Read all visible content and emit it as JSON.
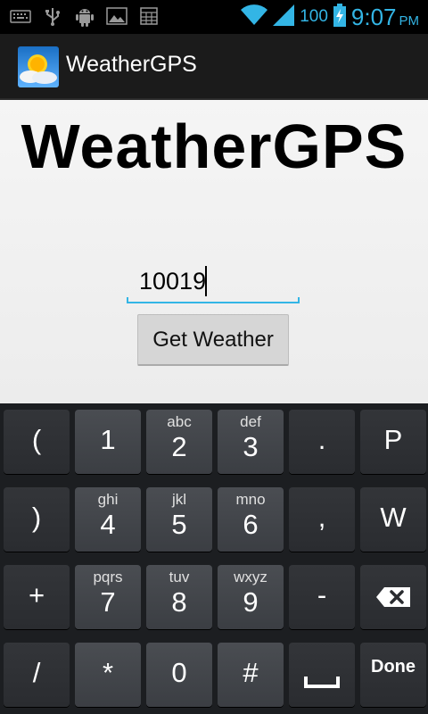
{
  "status_bar": {
    "battery": "100",
    "time": "9:07",
    "ampm": "PM",
    "left_icons": [
      "keyboard-icon",
      "usb-icon",
      "android-debug-icon",
      "image-icon",
      "calendar-icon"
    ],
    "right_icons": [
      "wifi-icon",
      "signal-icon",
      "battery-charging-icon"
    ],
    "accent": "#33b5e5"
  },
  "action_bar": {
    "title": "WeatherGPS",
    "icon": "weather-app-icon"
  },
  "main": {
    "heading": "WeatherGPS",
    "zip_value": "10019",
    "button_label": "Get Weather"
  },
  "keyboard": {
    "rows": [
      [
        {
          "main": "("
        },
        {
          "main": "1"
        },
        {
          "sub": "abc",
          "main": "2"
        },
        {
          "sub": "def",
          "main": "3"
        },
        {
          "main": "."
        },
        {
          "main": "P"
        }
      ],
      [
        {
          "main": ")"
        },
        {
          "sub": "ghi",
          "main": "4"
        },
        {
          "sub": "jkl",
          "main": "5"
        },
        {
          "sub": "mno",
          "main": "6"
        },
        {
          "main": ","
        },
        {
          "main": "W"
        }
      ],
      [
        {
          "main": "+"
        },
        {
          "sub": "pqrs",
          "main": "7"
        },
        {
          "sub": "tuv",
          "main": "8"
        },
        {
          "sub": "wxyz",
          "main": "9"
        },
        {
          "main": "-"
        },
        {
          "icon": "backspace-icon"
        }
      ],
      [
        {
          "main": "/"
        },
        {
          "main": "*"
        },
        {
          "main": "0"
        },
        {
          "main": "#"
        },
        {
          "icon": "space-icon"
        },
        {
          "main": "Done"
        }
      ]
    ]
  }
}
